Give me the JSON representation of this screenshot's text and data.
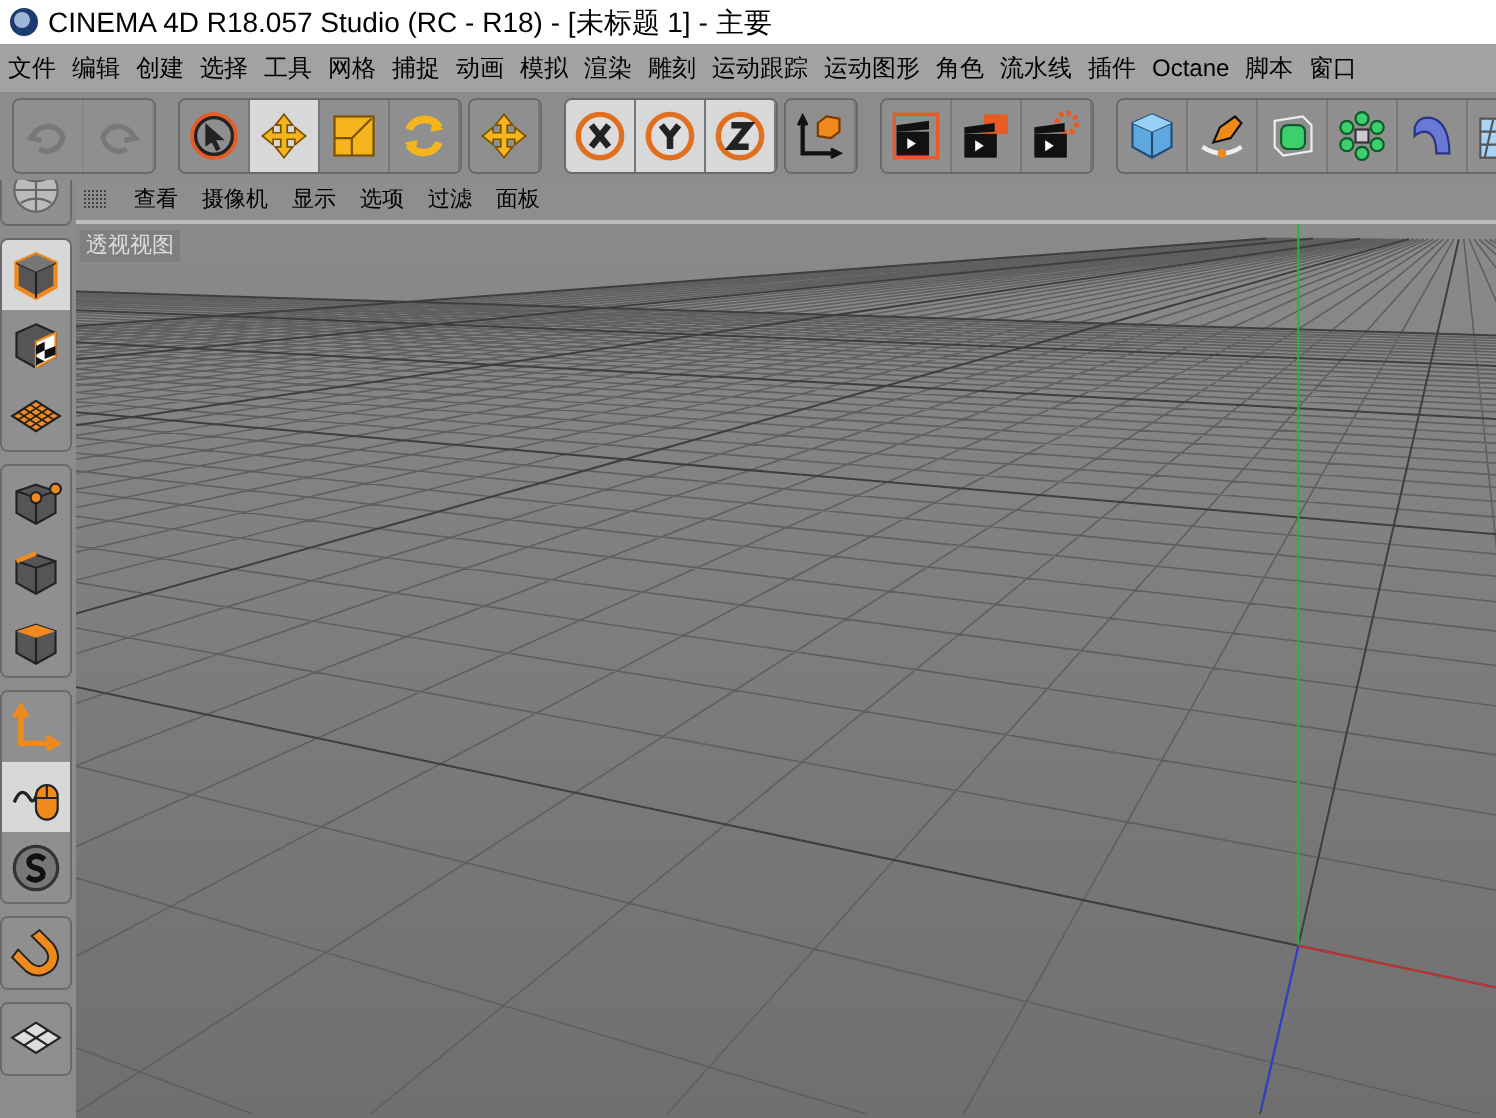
{
  "window": {
    "title": "CINEMA 4D R18.057 Studio (RC - R18) - [未标题 1] - 主要"
  },
  "menu": [
    "文件",
    "编辑",
    "创建",
    "选择",
    "工具",
    "网格",
    "捕捉",
    "动画",
    "模拟",
    "渲染",
    "雕刻",
    "运动跟踪",
    "运动图形",
    "角色",
    "流水线",
    "插件",
    "Octane",
    "脚本",
    "窗口"
  ],
  "toolbar": [
    {
      "tools": [
        {
          "kind": "undo",
          "selected": false,
          "disabled": true
        },
        {
          "kind": "redo",
          "selected": false,
          "disabled": true
        }
      ]
    },
    {
      "tools": [
        {
          "kind": "select",
          "selected": false,
          "disabled": false
        },
        {
          "kind": "move",
          "selected": true,
          "disabled": false
        },
        {
          "kind": "scale",
          "selected": false,
          "disabled": false
        },
        {
          "kind": "rotate",
          "selected": false,
          "disabled": false
        }
      ]
    },
    {
      "tools": [
        {
          "kind": "move",
          "selected": false,
          "disabled": false
        }
      ]
    },
    {
      "tools": [
        {
          "kind": "x",
          "selected": true,
          "disabled": false
        },
        {
          "kind": "y",
          "selected": true,
          "disabled": false
        },
        {
          "kind": "z",
          "selected": true,
          "disabled": false
        }
      ]
    },
    {
      "tools": [
        {
          "kind": "world",
          "selected": false,
          "disabled": false
        }
      ]
    },
    {
      "tools": [
        {
          "kind": "render-view",
          "selected": false,
          "disabled": false
        },
        {
          "kind": "render-picture",
          "selected": false,
          "disabled": false
        },
        {
          "kind": "render-settings",
          "selected": false,
          "disabled": false
        }
      ]
    },
    {
      "tools": [
        {
          "kind": "cube",
          "selected": false,
          "disabled": false
        },
        {
          "kind": "pen",
          "selected": false,
          "disabled": false
        },
        {
          "kind": "subdivision",
          "selected": false,
          "disabled": false
        },
        {
          "kind": "cloner",
          "selected": false,
          "disabled": false
        },
        {
          "kind": "bend",
          "selected": false,
          "disabled": false
        },
        {
          "kind": "floor",
          "selected": false,
          "disabled": false
        }
      ]
    }
  ],
  "viewport_menu": [
    "查看",
    "摄像机",
    "显示",
    "选项",
    "过滤",
    "面板"
  ],
  "viewport": {
    "label": "透视视图"
  },
  "left_toolbar": [
    {
      "tools": [
        {
          "kind": "globe",
          "selected": false
        }
      ]
    },
    {
      "tools": [
        {
          "kind": "model",
          "selected": true
        },
        {
          "kind": "texture",
          "selected": false
        },
        {
          "kind": "workplane",
          "selected": false
        }
      ]
    },
    {
      "tools": [
        {
          "kind": "points",
          "selected": false
        },
        {
          "kind": "edges",
          "selected": false
        },
        {
          "kind": "polygons",
          "selected": false
        }
      ]
    },
    {
      "tools": [
        {
          "kind": "axis",
          "selected": false
        },
        {
          "kind": "tweak",
          "selected": true
        },
        {
          "kind": "solo",
          "selected": false
        }
      ]
    },
    {
      "tools": [
        {
          "kind": "snap",
          "selected": false
        }
      ]
    },
    {
      "tools": [
        {
          "kind": "grid",
          "selected": false
        }
      ]
    }
  ]
}
